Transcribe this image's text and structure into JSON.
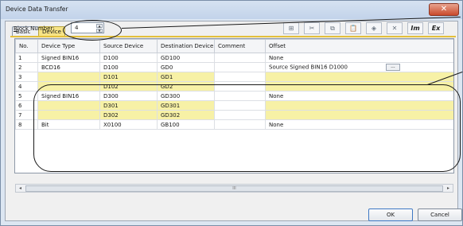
{
  "window": {
    "title": "Device Data Transfer",
    "close_label": "✕"
  },
  "tabs": [
    {
      "label": "Basic"
    },
    {
      "label": "Device"
    }
  ],
  "block_number": {
    "label_prefix": "B",
    "label_rest": "lock Number:",
    "value": "4"
  },
  "toolbar": [
    {
      "icon": "insert-row-icon",
      "glyph": "⊞"
    },
    {
      "icon": "cut-icon",
      "glyph": "✂"
    },
    {
      "icon": "copy-icon",
      "glyph": "⧉"
    },
    {
      "icon": "paste-icon",
      "glyph": "📋"
    },
    {
      "icon": "clear-icon",
      "glyph": "◈"
    },
    {
      "icon": "delete-icon",
      "glyph": "✕"
    },
    {
      "icon": "import-icon",
      "glyph": "Im"
    },
    {
      "icon": "export-icon",
      "glyph": "Ex"
    }
  ],
  "grid": {
    "columns": [
      "No.",
      "Device Type",
      "Source Device",
      "Destination Device",
      "Comment",
      "Offset"
    ],
    "rows": [
      {
        "no": "1",
        "type": "Signed BIN16",
        "source": "D100",
        "dest": "GD100",
        "comment": "",
        "offset": "None",
        "sub": false,
        "dots": false
      },
      {
        "no": "2",
        "type": "BCD16",
        "source": "D100",
        "dest": "GD0",
        "comment": "",
        "offset": "Source Signed BIN16 D1000",
        "sub": false,
        "dots": true
      },
      {
        "no": "3",
        "type": "",
        "source": "D101",
        "dest": "GD1",
        "comment": "",
        "offset": "",
        "sub": true,
        "dots": false
      },
      {
        "no": "4",
        "type": "",
        "source": "D102",
        "dest": "GD2",
        "comment": "",
        "offset": "",
        "sub": true,
        "dots": false
      },
      {
        "no": "5",
        "type": "Signed BIN16",
        "source": "D300",
        "dest": "GD300",
        "comment": "",
        "offset": "None",
        "sub": false,
        "dots": false
      },
      {
        "no": "6",
        "type": "",
        "source": "D301",
        "dest": "GD301",
        "comment": "",
        "offset": "",
        "sub": true,
        "dots": false
      },
      {
        "no": "7",
        "type": "",
        "source": "D302",
        "dest": "GD302",
        "comment": "",
        "offset": "",
        "sub": true,
        "dots": false
      },
      {
        "no": "8",
        "type": "Bit",
        "source": "X0100",
        "dest": "GB100",
        "comment": "",
        "offset": "None",
        "sub": false,
        "dots": false
      }
    ],
    "dots_label": "...",
    "scroll_thumb_label": "III"
  },
  "buttons": {
    "ok": "OK",
    "cancel": "Cancel"
  }
}
